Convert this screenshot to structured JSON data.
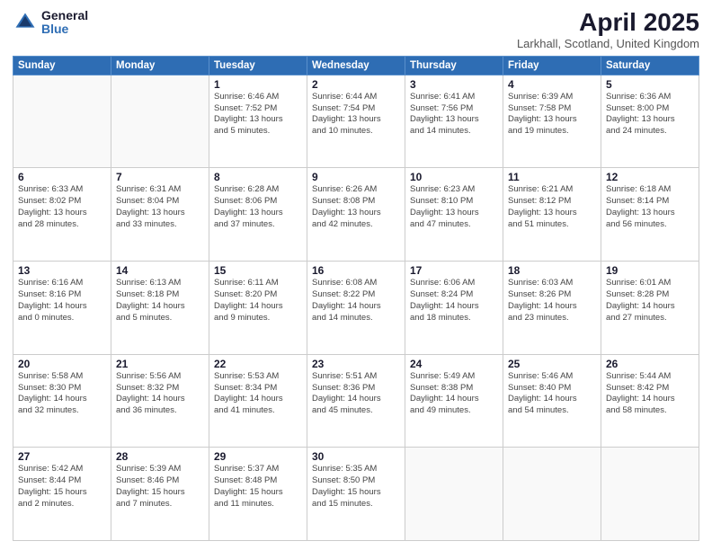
{
  "header": {
    "logo_general": "General",
    "logo_blue": "Blue",
    "month_title": "April 2025",
    "location": "Larkhall, Scotland, United Kingdom"
  },
  "days_of_week": [
    "Sunday",
    "Monday",
    "Tuesday",
    "Wednesday",
    "Thursday",
    "Friday",
    "Saturday"
  ],
  "weeks": [
    [
      {
        "day": "",
        "info": ""
      },
      {
        "day": "",
        "info": ""
      },
      {
        "day": "1",
        "info": "Sunrise: 6:46 AM\nSunset: 7:52 PM\nDaylight: 13 hours\nand 5 minutes."
      },
      {
        "day": "2",
        "info": "Sunrise: 6:44 AM\nSunset: 7:54 PM\nDaylight: 13 hours\nand 10 minutes."
      },
      {
        "day": "3",
        "info": "Sunrise: 6:41 AM\nSunset: 7:56 PM\nDaylight: 13 hours\nand 14 minutes."
      },
      {
        "day": "4",
        "info": "Sunrise: 6:39 AM\nSunset: 7:58 PM\nDaylight: 13 hours\nand 19 minutes."
      },
      {
        "day": "5",
        "info": "Sunrise: 6:36 AM\nSunset: 8:00 PM\nDaylight: 13 hours\nand 24 minutes."
      }
    ],
    [
      {
        "day": "6",
        "info": "Sunrise: 6:33 AM\nSunset: 8:02 PM\nDaylight: 13 hours\nand 28 minutes."
      },
      {
        "day": "7",
        "info": "Sunrise: 6:31 AM\nSunset: 8:04 PM\nDaylight: 13 hours\nand 33 minutes."
      },
      {
        "day": "8",
        "info": "Sunrise: 6:28 AM\nSunset: 8:06 PM\nDaylight: 13 hours\nand 37 minutes."
      },
      {
        "day": "9",
        "info": "Sunrise: 6:26 AM\nSunset: 8:08 PM\nDaylight: 13 hours\nand 42 minutes."
      },
      {
        "day": "10",
        "info": "Sunrise: 6:23 AM\nSunset: 8:10 PM\nDaylight: 13 hours\nand 47 minutes."
      },
      {
        "day": "11",
        "info": "Sunrise: 6:21 AM\nSunset: 8:12 PM\nDaylight: 13 hours\nand 51 minutes."
      },
      {
        "day": "12",
        "info": "Sunrise: 6:18 AM\nSunset: 8:14 PM\nDaylight: 13 hours\nand 56 minutes."
      }
    ],
    [
      {
        "day": "13",
        "info": "Sunrise: 6:16 AM\nSunset: 8:16 PM\nDaylight: 14 hours\nand 0 minutes."
      },
      {
        "day": "14",
        "info": "Sunrise: 6:13 AM\nSunset: 8:18 PM\nDaylight: 14 hours\nand 5 minutes."
      },
      {
        "day": "15",
        "info": "Sunrise: 6:11 AM\nSunset: 8:20 PM\nDaylight: 14 hours\nand 9 minutes."
      },
      {
        "day": "16",
        "info": "Sunrise: 6:08 AM\nSunset: 8:22 PM\nDaylight: 14 hours\nand 14 minutes."
      },
      {
        "day": "17",
        "info": "Sunrise: 6:06 AM\nSunset: 8:24 PM\nDaylight: 14 hours\nand 18 minutes."
      },
      {
        "day": "18",
        "info": "Sunrise: 6:03 AM\nSunset: 8:26 PM\nDaylight: 14 hours\nand 23 minutes."
      },
      {
        "day": "19",
        "info": "Sunrise: 6:01 AM\nSunset: 8:28 PM\nDaylight: 14 hours\nand 27 minutes."
      }
    ],
    [
      {
        "day": "20",
        "info": "Sunrise: 5:58 AM\nSunset: 8:30 PM\nDaylight: 14 hours\nand 32 minutes."
      },
      {
        "day": "21",
        "info": "Sunrise: 5:56 AM\nSunset: 8:32 PM\nDaylight: 14 hours\nand 36 minutes."
      },
      {
        "day": "22",
        "info": "Sunrise: 5:53 AM\nSunset: 8:34 PM\nDaylight: 14 hours\nand 41 minutes."
      },
      {
        "day": "23",
        "info": "Sunrise: 5:51 AM\nSunset: 8:36 PM\nDaylight: 14 hours\nand 45 minutes."
      },
      {
        "day": "24",
        "info": "Sunrise: 5:49 AM\nSunset: 8:38 PM\nDaylight: 14 hours\nand 49 minutes."
      },
      {
        "day": "25",
        "info": "Sunrise: 5:46 AM\nSunset: 8:40 PM\nDaylight: 14 hours\nand 54 minutes."
      },
      {
        "day": "26",
        "info": "Sunrise: 5:44 AM\nSunset: 8:42 PM\nDaylight: 14 hours\nand 58 minutes."
      }
    ],
    [
      {
        "day": "27",
        "info": "Sunrise: 5:42 AM\nSunset: 8:44 PM\nDaylight: 15 hours\nand 2 minutes."
      },
      {
        "day": "28",
        "info": "Sunrise: 5:39 AM\nSunset: 8:46 PM\nDaylight: 15 hours\nand 7 minutes."
      },
      {
        "day": "29",
        "info": "Sunrise: 5:37 AM\nSunset: 8:48 PM\nDaylight: 15 hours\nand 11 minutes."
      },
      {
        "day": "30",
        "info": "Sunrise: 5:35 AM\nSunset: 8:50 PM\nDaylight: 15 hours\nand 15 minutes."
      },
      {
        "day": "",
        "info": ""
      },
      {
        "day": "",
        "info": ""
      },
      {
        "day": "",
        "info": ""
      }
    ]
  ]
}
